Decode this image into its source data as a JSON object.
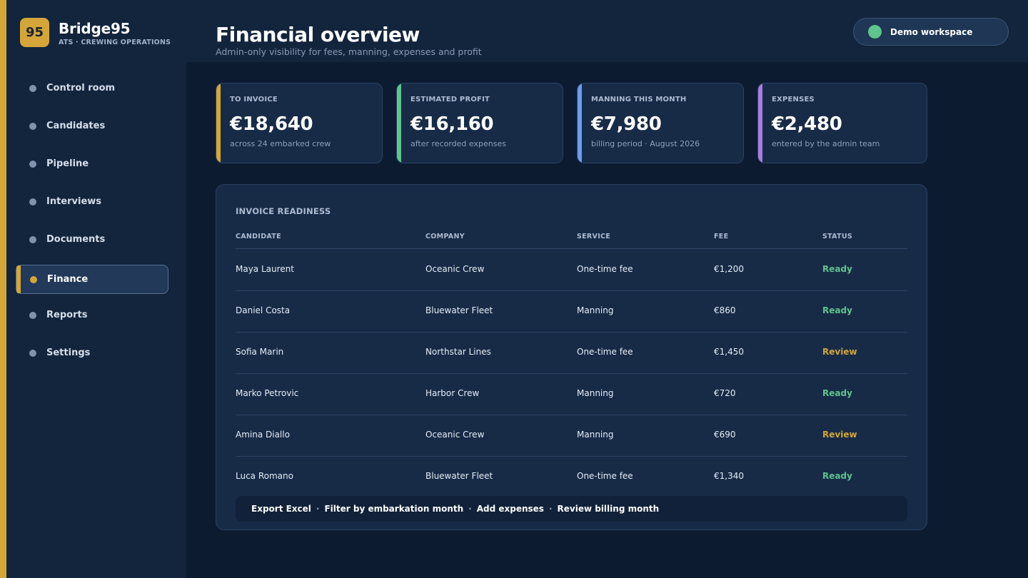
{
  "brand": {
    "badge": "95",
    "name": "Bridge95",
    "subtitle": "ATS · CREWING OPERATIONS"
  },
  "header": {
    "title": "Financial overview",
    "subtitle": "Admin-only visibility for fees, manning, expenses and profit"
  },
  "workspace": {
    "label": "Demo workspace",
    "status_color": "#5fc48d"
  },
  "colors": {
    "accent_gold": "#d4a63a",
    "ready_green": "#5fc48d",
    "review_gold": "#d4a63a",
    "manning_blue": "#6d9cf0",
    "expenses_purple": "#a77ee0"
  },
  "sidebar": {
    "items": [
      {
        "label": "Control room",
        "active": false
      },
      {
        "label": "Candidates",
        "active": false
      },
      {
        "label": "Pipeline",
        "active": false
      },
      {
        "label": "Interviews",
        "active": false
      },
      {
        "label": "Documents",
        "active": false
      },
      {
        "label": "Finance",
        "active": true
      },
      {
        "label": "Reports",
        "active": false
      },
      {
        "label": "Settings",
        "active": false
      }
    ]
  },
  "kpis": [
    {
      "label": "TO INVOICE",
      "value": "€18,640",
      "note": "across 24 embarked crew",
      "accent": "#d4a63a"
    },
    {
      "label": "ESTIMATED PROFIT",
      "value": "€16,160",
      "note": "after recorded expenses",
      "accent": "#5fc48d"
    },
    {
      "label": "MANNING THIS MONTH",
      "value": "€7,980",
      "note": "billing period · August 2026",
      "accent": "#6d9cf0"
    },
    {
      "label": "EXPENSES",
      "value": "€2,480",
      "note": "entered by the admin team",
      "accent": "#a77ee0"
    }
  ],
  "invoice": {
    "title": "INVOICE READINESS",
    "columns": [
      "CANDIDATE",
      "COMPANY",
      "SERVICE",
      "FEE",
      "STATUS"
    ],
    "rows": [
      {
        "candidate": "Maya Laurent",
        "company": "Oceanic Crew",
        "service": "One-time fee",
        "fee": "€1,200",
        "status": "Ready"
      },
      {
        "candidate": "Daniel Costa",
        "company": "Bluewater Fleet",
        "service": "Manning",
        "fee": "€860",
        "status": "Ready"
      },
      {
        "candidate": "Sofia Marin",
        "company": "Northstar Lines",
        "service": "One-time fee",
        "fee": "€1,450",
        "status": "Review"
      },
      {
        "candidate": "Marko Petrovic",
        "company": "Harbor Crew",
        "service": "Manning",
        "fee": "€720",
        "status": "Ready"
      },
      {
        "candidate": "Amina Diallo",
        "company": "Oceanic Crew",
        "service": "Manning",
        "fee": "€690",
        "status": "Review"
      },
      {
        "candidate": "Luca Romano",
        "company": "Bluewater Fleet",
        "service": "One-time fee",
        "fee": "€1,340",
        "status": "Ready"
      }
    ]
  },
  "actions": {
    "separator": "·",
    "items": [
      "Export Excel",
      "Filter by embarkation month",
      "Add expenses",
      "Review billing month"
    ]
  }
}
